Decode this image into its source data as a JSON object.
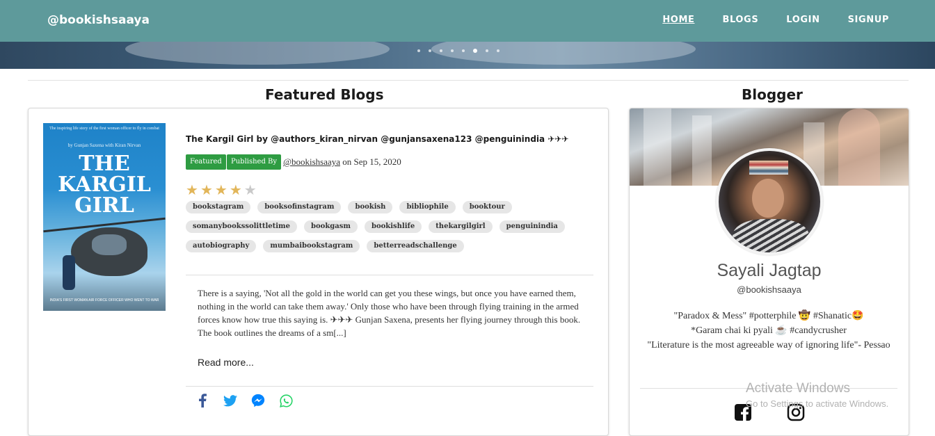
{
  "navbar": {
    "brand": "@bookishsaaya",
    "links": [
      "HOME",
      "BLOGS",
      "LOGIN",
      "SIGNUP"
    ],
    "active": "HOME",
    "color": "#5e9a9b"
  },
  "carousel": {
    "slide_count": 8,
    "active_slide": 6
  },
  "featured": {
    "heading": "Featured Blogs",
    "post": {
      "cover": {
        "title": "THE KARGIL GIRL",
        "line_top": "The inspiring life story of the first woman officer to fly in combat",
        "authors": "by Gunjan Saxena with Kiran Nirvan",
        "bottom": "INDIA'S FIRST WOMAN AIR FORCE OFFICER WHO WENT TO WAR"
      },
      "title": "The Kargil Girl by @authors_kiran_nirvan @gunjansaxena123 @penguinindia ✈✈✈",
      "badge_featured": "Featured",
      "badge_published": "Published By",
      "author": "@bookishsaaya",
      "date_text": "on Sep 15, 2020",
      "rating": 4,
      "rating_max": 5,
      "tags": [
        "bookstagram",
        "booksofinstagram",
        "bookish",
        "bibliophile",
        "booktour",
        "somanybookssolittletime",
        "bookgasm",
        "bookishlife",
        "thekargilgirl",
        "penguinindia",
        "autobiography",
        "mumbaibookstagram",
        "betterreadschallenge"
      ],
      "excerpt": "There is a saying, 'Not all the gold in the world can get you these wings, but once you have earned them, nothing in the world can take them away.' Only those who have been through flying training in the armed forces know how true this saying is. ✈✈✈ Gunjan Saxena, presents her flying journey through this book. The book outlines the dreams of a sm[...]",
      "read_more": "Read more...",
      "share_icons": [
        "facebook-icon",
        "twitter-icon",
        "messenger-icon",
        "whatsapp-icon"
      ]
    }
  },
  "blogger": {
    "heading": "Blogger",
    "name": "Sayali Jagtap",
    "handle": "@bookishsaaya",
    "bio_line1": "\"Paradox & Mess\" #potterphile 🤠 #Shanatic🤩",
    "bio_line2": "*Garam chai ki pyali ☕ #candycrusher",
    "bio_line3": "\"Literature is the most agreeable way of ignoring life\"- Pessao",
    "social_icons": [
      "facebook-square-icon",
      "instagram-icon"
    ]
  },
  "watermark": {
    "title": "Activate Windows",
    "subtitle": "Go to Settings to activate Windows."
  },
  "colors": {
    "badge_green": "#2e9c42",
    "star": "#e2b65a",
    "star_empty": "#c9c9c9"
  }
}
